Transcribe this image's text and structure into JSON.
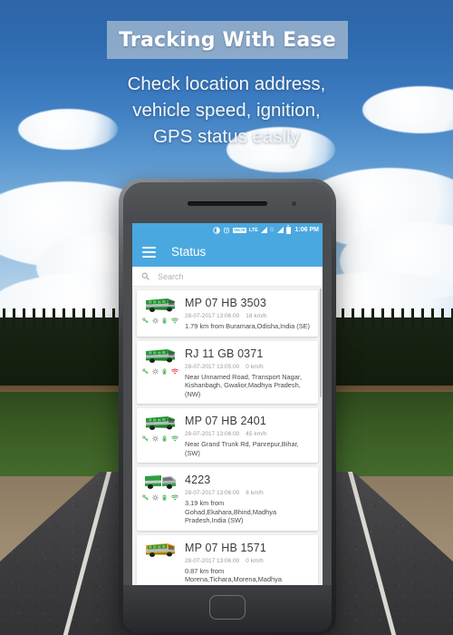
{
  "promo": {
    "banner_title": "Tracking With Ease",
    "subhead_lines": [
      "Check location address,",
      "vehicle speed, ignition,",
      "GPS status easily"
    ]
  },
  "statusbar": {
    "icons": [
      "brightness-icon",
      "alarm-icon",
      "volte-icon",
      "lte-icon",
      "signal-icon",
      "g-network-icon",
      "signal-icon-2",
      "battery-icon"
    ],
    "volte_label": "VoLTE",
    "lte_label": "LTE",
    "g_label": "G",
    "time": "1:06 PM"
  },
  "appbar": {
    "menu_icon": "hamburger-menu-icon",
    "title": "Status"
  },
  "search": {
    "icon": "search-icon",
    "placeholder": "Search",
    "value": ""
  },
  "list": {
    "items": [
      {
        "plate": "MP 07 HB 3503",
        "timestamp": "28-07-2017 13:06:00",
        "speed": "18 km/h",
        "address": "1.79 km from Buramara,Odisha,India (SE)",
        "vehicle_type": "bus",
        "vehicle_color": "#2f9e3f",
        "status_icons": [
          {
            "name": "ignition-key-icon",
            "color": "#3cab4a"
          },
          {
            "name": "gear-icon",
            "color": "#9a9a9a"
          },
          {
            "name": "battery-icon",
            "color": "#3cab4a"
          },
          {
            "name": "gps-signal-icon",
            "color": "#3cab4a"
          }
        ]
      },
      {
        "plate": "RJ 11 GB 0371",
        "timestamp": "28-07-2017 13:05:00",
        "speed": "0 km/h",
        "address": "Near Unnamed Road, Transport Nagar, Kishanbagh, Gwalior,Madhya Pradesh, (NW)",
        "vehicle_type": "bus",
        "vehicle_color": "#2f9e3f",
        "status_icons": [
          {
            "name": "ignition-key-icon",
            "color": "#3cab4a"
          },
          {
            "name": "gear-icon",
            "color": "#9a9a9a"
          },
          {
            "name": "battery-icon",
            "color": "#3cab4a"
          },
          {
            "name": "gps-signal-icon",
            "color": "#e03b3b"
          }
        ]
      },
      {
        "plate": "MP 07 HB 2401",
        "timestamp": "28-07-2017 13:06:00",
        "speed": "45 km/h",
        "address": "Near Grand Trunk Rd, Panrepur,Bihar, (SW)",
        "vehicle_type": "bus",
        "vehicle_color": "#2f9e3f",
        "status_icons": [
          {
            "name": "ignition-key-icon",
            "color": "#3cab4a"
          },
          {
            "name": "gear-icon",
            "color": "#9a9a9a"
          },
          {
            "name": "battery-icon",
            "color": "#3cab4a"
          },
          {
            "name": "gps-signal-icon",
            "color": "#3cab4a"
          }
        ]
      },
      {
        "plate": "4223",
        "timestamp": "28-07-2017 13:06:00",
        "speed": "8 km/h",
        "address": "3.19 km from Gohad,Ekahara,Bhind,Madhya Pradesh,India (SW)",
        "vehicle_type": "truck",
        "vehicle_color": "#2f9e3f",
        "status_icons": [
          {
            "name": "ignition-key-icon",
            "color": "#3cab4a"
          },
          {
            "name": "gear-icon",
            "color": "#9a9a9a"
          },
          {
            "name": "battery-icon",
            "color": "#3cab4a"
          },
          {
            "name": "gps-signal-icon",
            "color": "#3cab4a"
          }
        ]
      },
      {
        "plate": "MP 07 HB 1571",
        "timestamp": "28-07-2017 13:06:00",
        "speed": "0 km/h",
        "address": "0.87 km from Morena,Tichara,Morena,Madhya",
        "vehicle_type": "bus",
        "vehicle_color": "#e8a317",
        "status_icons": []
      }
    ]
  },
  "navbar": {
    "back": "back-nav-icon",
    "home": "home-nav-icon",
    "recents": "recents-nav-icon"
  },
  "colors": {
    "accent": "#4aa8e0",
    "banner_bg": "#adc0d4",
    "card_bg": "#ffffff",
    "list_bg": "#f2f2f2"
  }
}
